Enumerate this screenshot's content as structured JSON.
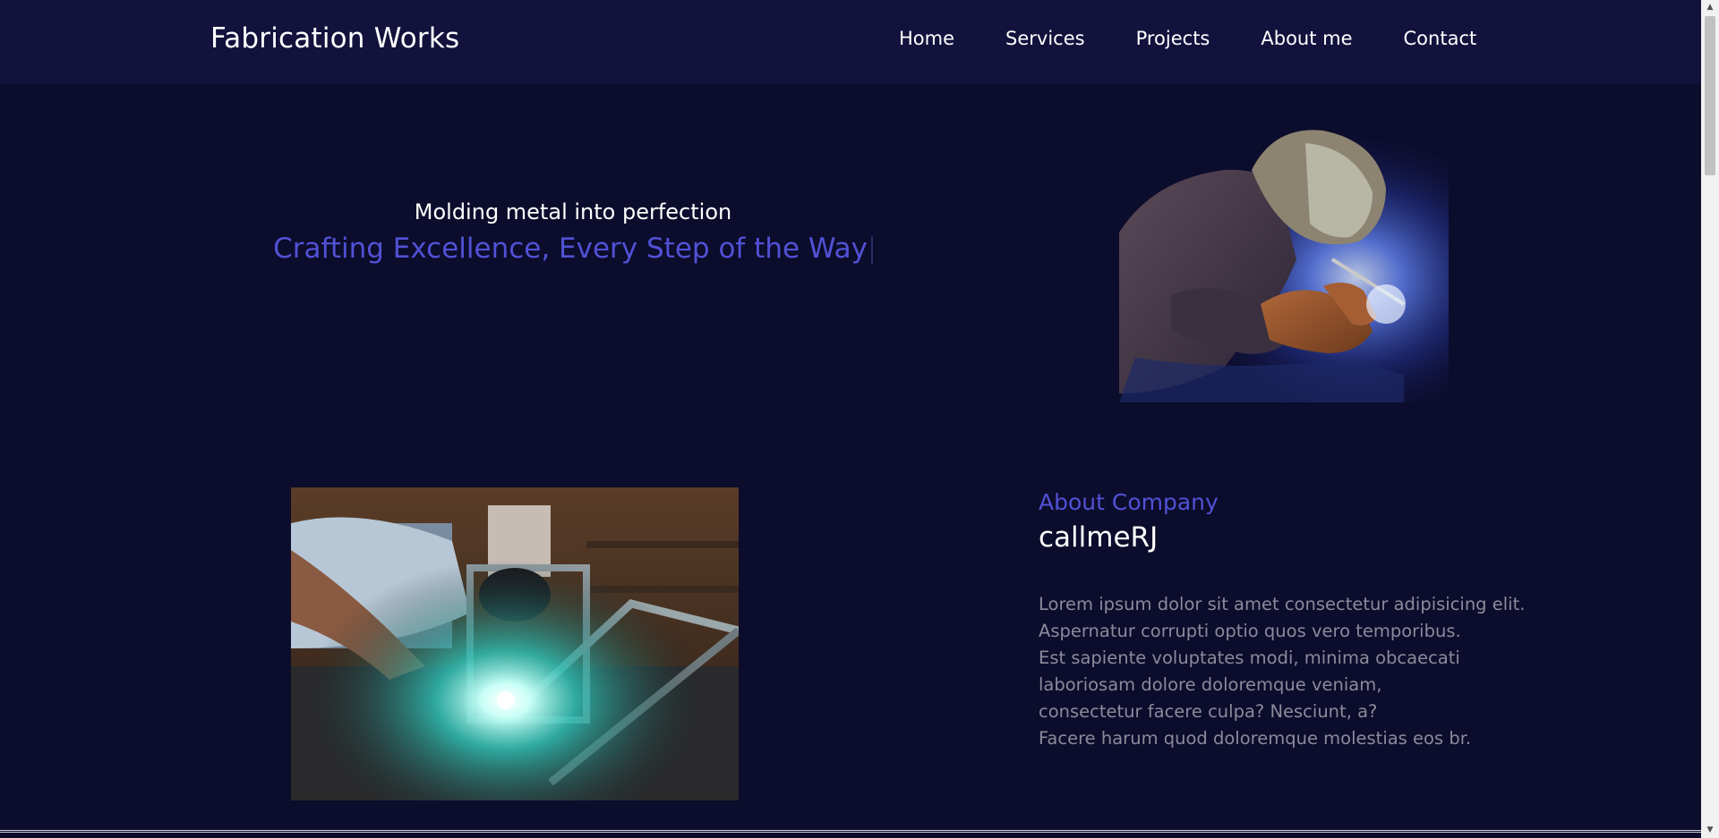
{
  "nav": {
    "brand": "Fabrication Works",
    "links": [
      "Home",
      "Services",
      "Projects",
      "About me",
      "Contact"
    ]
  },
  "hero": {
    "subtitle": "Molding metal into perfection",
    "tagline": "Crafting Excellence, Every Step of the Way"
  },
  "about": {
    "kicker": "About Company",
    "name": "callmeRJ",
    "body_lines": [
      "Lorem ipsum dolor sit amet consectetur adipisicing elit.",
      "Aspernatur corrupti optio quos vero temporibus.",
      "Est sapiente voluptates modi, minima obcaecati",
      "laboriosam dolore doloremque veniam,",
      "consectetur facere culpa? Nesciunt, a?",
      "Facere harum quod doloremque molestias eos br."
    ]
  },
  "colors": {
    "background": "#0c0c2c",
    "navbar": "#12123d",
    "accent": "#5151d6",
    "body_text": "#8c8a9b"
  }
}
